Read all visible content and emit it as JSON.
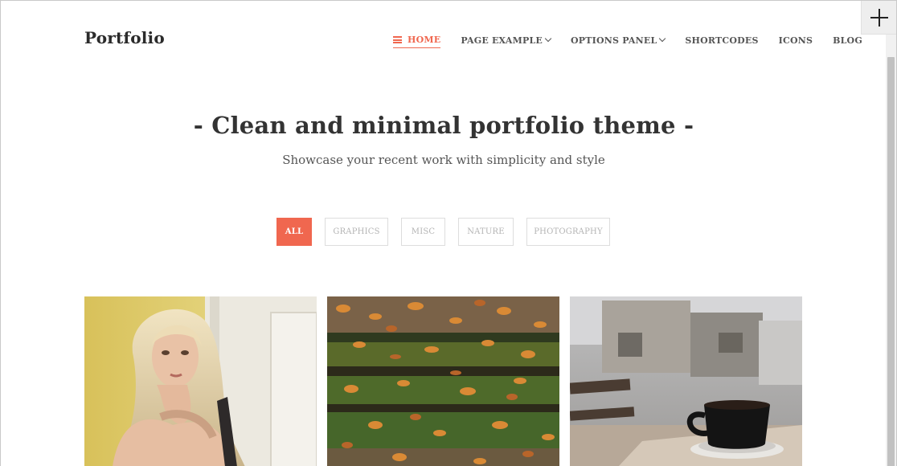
{
  "header": {
    "logo": "Portfolio",
    "nav": [
      {
        "label": "HOME",
        "active": true
      },
      {
        "label": "PAGE EXAMPLE",
        "dropdown": true
      },
      {
        "label": "OPTIONS PANEL",
        "dropdown": true
      },
      {
        "label": "SHORTCODES"
      },
      {
        "label": "ICONS"
      },
      {
        "label": "BLOG"
      }
    ]
  },
  "hero": {
    "title": "- Clean and minimal portfolio theme -",
    "subtitle": "Showcase your recent work with simplicity and style"
  },
  "filters": [
    {
      "label": "ALL",
      "active": true
    },
    {
      "label": "GRAPHICS"
    },
    {
      "label": "MISC"
    },
    {
      "label": "NATURE"
    },
    {
      "label": "PHOTOGRAPHY"
    }
  ],
  "gallery": {
    "items": [
      {
        "image": "woman-portrait-photo"
      },
      {
        "image": "autumn-leaves-steps-photo"
      },
      {
        "image": "coffee-cup-photo"
      }
    ]
  },
  "colors": {
    "accent": "#f0674f",
    "text": "#333333",
    "border": "#dddddd"
  }
}
